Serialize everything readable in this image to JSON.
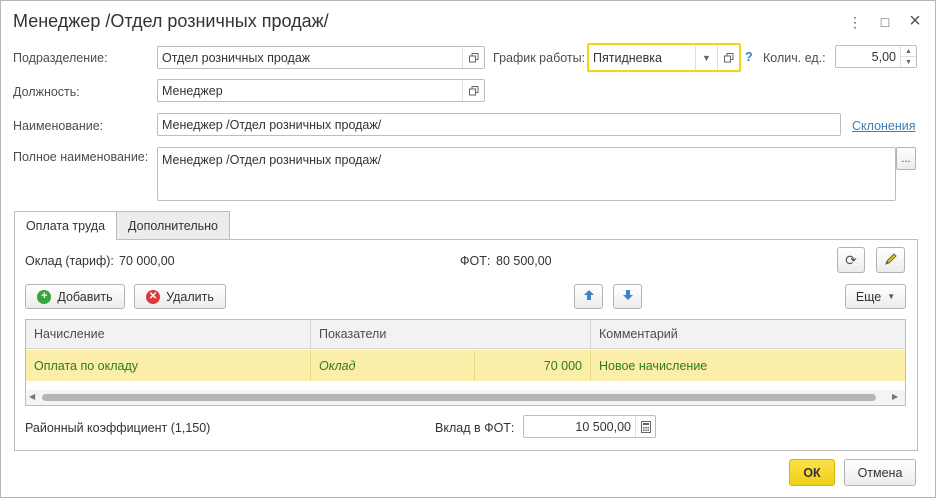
{
  "window": {
    "title": "Менеджер /Отдел розничных продаж/",
    "more_icon": "⋮",
    "maximize_icon": "□",
    "close_icon": "×"
  },
  "form": {
    "subdivision_label": "Подразделение:",
    "subdivision_value": "Отдел розничных продаж",
    "schedule_label": "График работы:",
    "schedule_value": "Пятидневка",
    "help_icon": "?",
    "quantity_label": "Колич. ед.:",
    "quantity_value": "5,00",
    "position_label": "Должность:",
    "position_value": "Менеджер",
    "name_label": "Наименование:",
    "name_value": "Менеджер /Отдел розничных продаж/",
    "declension_link": "Склонения",
    "fullname_label": "Полное наименование:",
    "fullname_value": "Менеджер /Отдел розничных продаж/",
    "ellipsis": "..."
  },
  "tabs": [
    {
      "label": "Оплата труда",
      "active": true
    },
    {
      "label": "Дополнительно",
      "active": false
    }
  ],
  "pay": {
    "salary_label": "Оклад (тариф):",
    "salary_value": "70 000,00",
    "fot_label": "ФОТ:",
    "fot_value": "80 500,00",
    "add_button": "Добавить",
    "delete_button": "Удалить",
    "more_button": "Еще",
    "columns": [
      "Начисление",
      "Показатели",
      "Комментарий"
    ],
    "rows": [
      {
        "accrual": "Оплата по окладу",
        "indicator": "Оклад",
        "amount": "70 000",
        "comment": "Новое начисление"
      }
    ],
    "district_coef_label": "Районный коэффициент (1,150)",
    "fot_contribution_label": "Вклад в ФОТ:",
    "fot_contribution_value": "10 500,00"
  },
  "footer": {
    "ok_button": "ОК",
    "cancel_button": "Отмена"
  },
  "colors": {
    "accent_yellow": "#f5d511",
    "selected_row": "#fbeea8",
    "link_blue": "#3e7fb5",
    "add_green": "#3aa53a",
    "delete_red": "#d93a3a",
    "arrow_blue": "#3b84c9"
  }
}
